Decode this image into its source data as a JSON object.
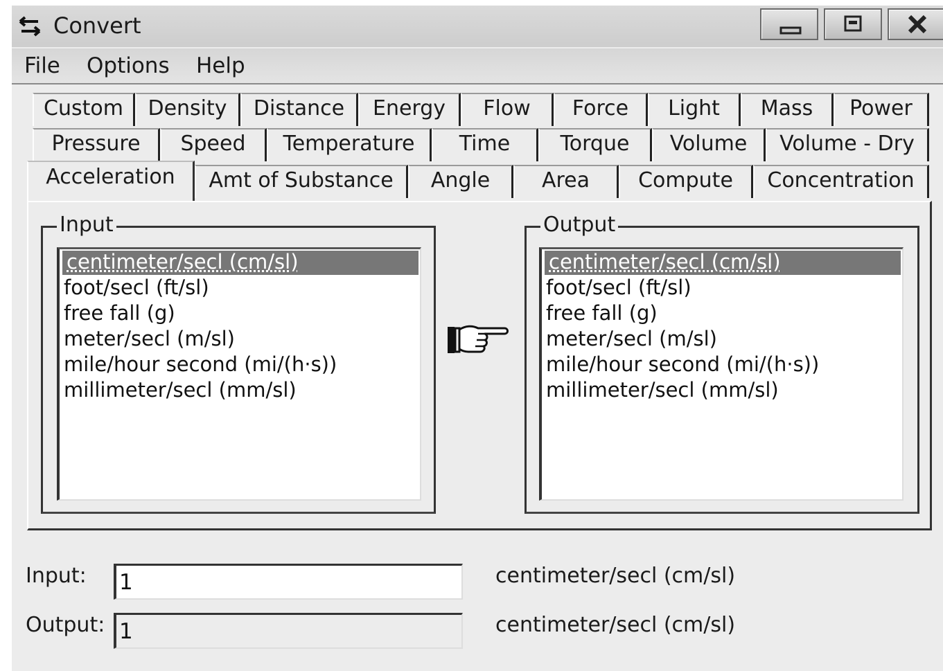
{
  "window": {
    "title": "Convert"
  },
  "menu": [
    "File",
    "Options",
    "Help"
  ],
  "tabs": {
    "row1": [
      "Custom",
      "Density",
      "Distance",
      "Energy",
      "Flow",
      "Force",
      "Light",
      "Mass",
      "Power"
    ],
    "row2": [
      "Pressure",
      "Speed",
      "Temperature",
      "Time",
      "Torque",
      "Volume",
      "Volume - Dry"
    ],
    "row3": [
      "Acceleration",
      "Amt of Substance",
      "Angle",
      "Area",
      "Compute",
      "Concentration"
    ],
    "active": "Acceleration"
  },
  "input_group": {
    "label": "Input",
    "items": [
      "centimeter/secl (cm/sl)",
      "foot/secl (ft/sl)",
      "free fall (g)",
      "meter/secl (m/sl)",
      "mile/hour second (mi/(h·s))",
      "millimeter/secl (mm/sl)"
    ],
    "selected": "centimeter/secl (cm/sl)"
  },
  "output_group": {
    "label": "Output",
    "items": [
      "centimeter/secl (cm/sl)",
      "foot/secl (ft/sl)",
      "free fall (g)",
      "meter/secl (m/sl)",
      "mile/hour second (mi/(h·s))",
      "millimeter/secl (mm/sl)"
    ],
    "selected": "centimeter/secl (cm/sl)"
  },
  "fields": {
    "input_label": "Input:",
    "input_value": "1",
    "input_unit": "centimeter/secl (cm/sl)",
    "output_label": "Output:",
    "output_value": "1",
    "output_unit": "centimeter/secl (cm/sl)"
  },
  "icons": {
    "app": "convert-arrows-icon",
    "minimize": "minimize-icon",
    "maximize": "maximize-icon",
    "close": "close-icon",
    "pointer": "pointing-hand-icon"
  }
}
